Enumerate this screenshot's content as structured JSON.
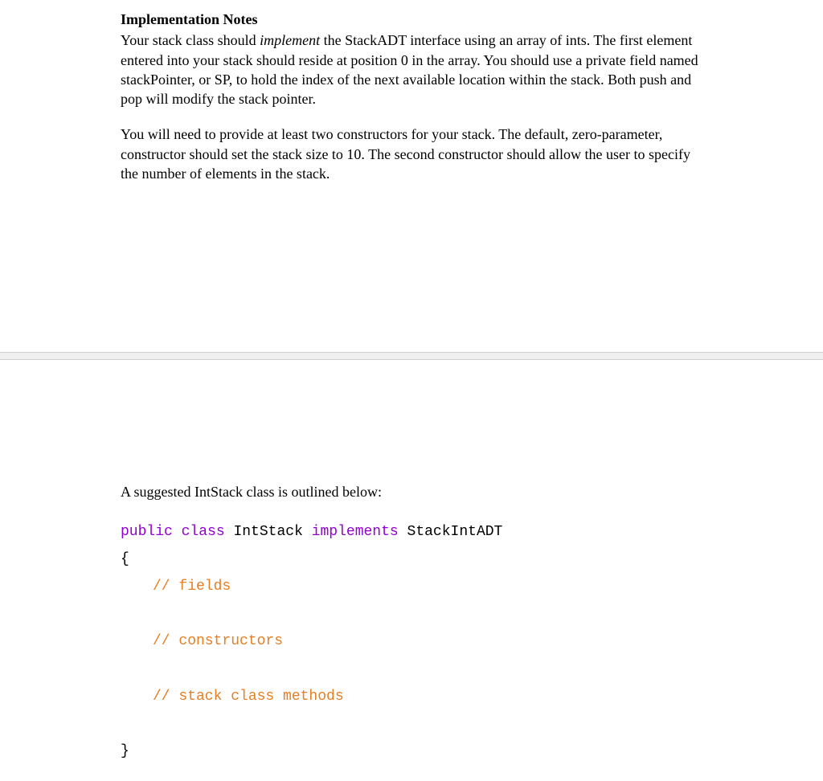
{
  "section1": {
    "heading": "Implementation Notes",
    "para1_pre": "Your stack class should ",
    "para1_em": "implement",
    "para1_post": " the StackADT interface using an array of ints. The first element entered into your stack should reside at position 0 in the array. You should use a private field named stackPointer, or SP, to hold the index of the next available location within the stack. Both push and pop will modify the stack pointer.",
    "para2": "You will need to provide at least two constructors for your stack. The default, zero-parameter, constructor should set the stack size to 10. The second constructor should allow the user to specify the number of elements in the stack."
  },
  "section2": {
    "intro": "A suggested IntStack class is outlined below:",
    "code": {
      "kw_public": "public",
      "kw_class": "class",
      "classname": "IntStack",
      "kw_implements": "implements",
      "interfacename": "StackIntADT",
      "brace_open": "{",
      "comment_fields": "// fields",
      "comment_constructors": "// constructors",
      "comment_methods": "// stack class methods",
      "brace_close": "}"
    }
  }
}
